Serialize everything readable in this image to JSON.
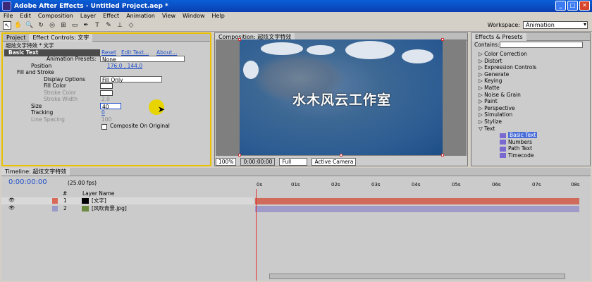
{
  "window": {
    "title": "Adobe After Effects - Untitled Project.aep *"
  },
  "menu": [
    "File",
    "Edit",
    "Composition",
    "Layer",
    "Effect",
    "Animation",
    "View",
    "Window",
    "Help"
  ],
  "workspace": {
    "label": "Workspace:",
    "value": "Animation"
  },
  "left_panel": {
    "tabs": [
      "Project",
      "Effect Controls: 文字"
    ],
    "comp_path": "超炫文字特效 * 文字",
    "effect_name": "Basic Text",
    "reset": "Reset",
    "edit_text": "Edit Text...",
    "about": "About...",
    "animation_presets_label": "Animation Presets:",
    "animation_presets_value": "None",
    "position_label": "Position",
    "position_value": "176.0 , 144.0",
    "fill_stroke": "Fill and Stroke",
    "display_options_label": "Display Options",
    "display_options_value": "Fill Only",
    "fill_color": "Fill Color",
    "stroke_color": "Stroke Color",
    "stroke_width_label": "Stroke Width",
    "stroke_width_value": "2.0",
    "size_label": "Size",
    "size_value": "40",
    "tracking_label": "Tracking",
    "tracking_value": "0",
    "line_spacing_label": "Line Spacing",
    "line_spacing_value": "100",
    "composite_label": "Composite On Original"
  },
  "composition": {
    "tab": "Composition: 超炫文字特效",
    "text": "水木风云工作室",
    "zoom": "100%",
    "timecode": "0:00:00:00",
    "quality": "Full",
    "camera": "Active Camera"
  },
  "effects_panel": {
    "tab": "Effects & Presets",
    "contains": "Contains:",
    "items": [
      "Color Correction",
      "Distort",
      "Expression Controls",
      "Generate",
      "Keying",
      "Matte",
      "Noise & Grain",
      "Paint",
      "Perspective",
      "Simulation",
      "Stylize",
      "Text"
    ],
    "text_children": [
      "Basic Text",
      "Numbers",
      "Path Text",
      "Timecode"
    ]
  },
  "timeline": {
    "tab": "Timeline: 超炫文字特效",
    "timecode": "0:00:00:00",
    "fps": "(25.00 fps)",
    "col_num": "#",
    "col_layer": "Layer Name",
    "ruler": [
      "0s",
      "01s",
      "02s",
      "03s",
      "04s",
      "05s",
      "06s",
      "07s",
      "08s"
    ],
    "layers": [
      {
        "num": "1",
        "name": "[文字]",
        "color": "#d96a5a"
      },
      {
        "num": "2",
        "name": "[风吹青景.jpg]",
        "color": "#9a9ac8"
      }
    ]
  }
}
